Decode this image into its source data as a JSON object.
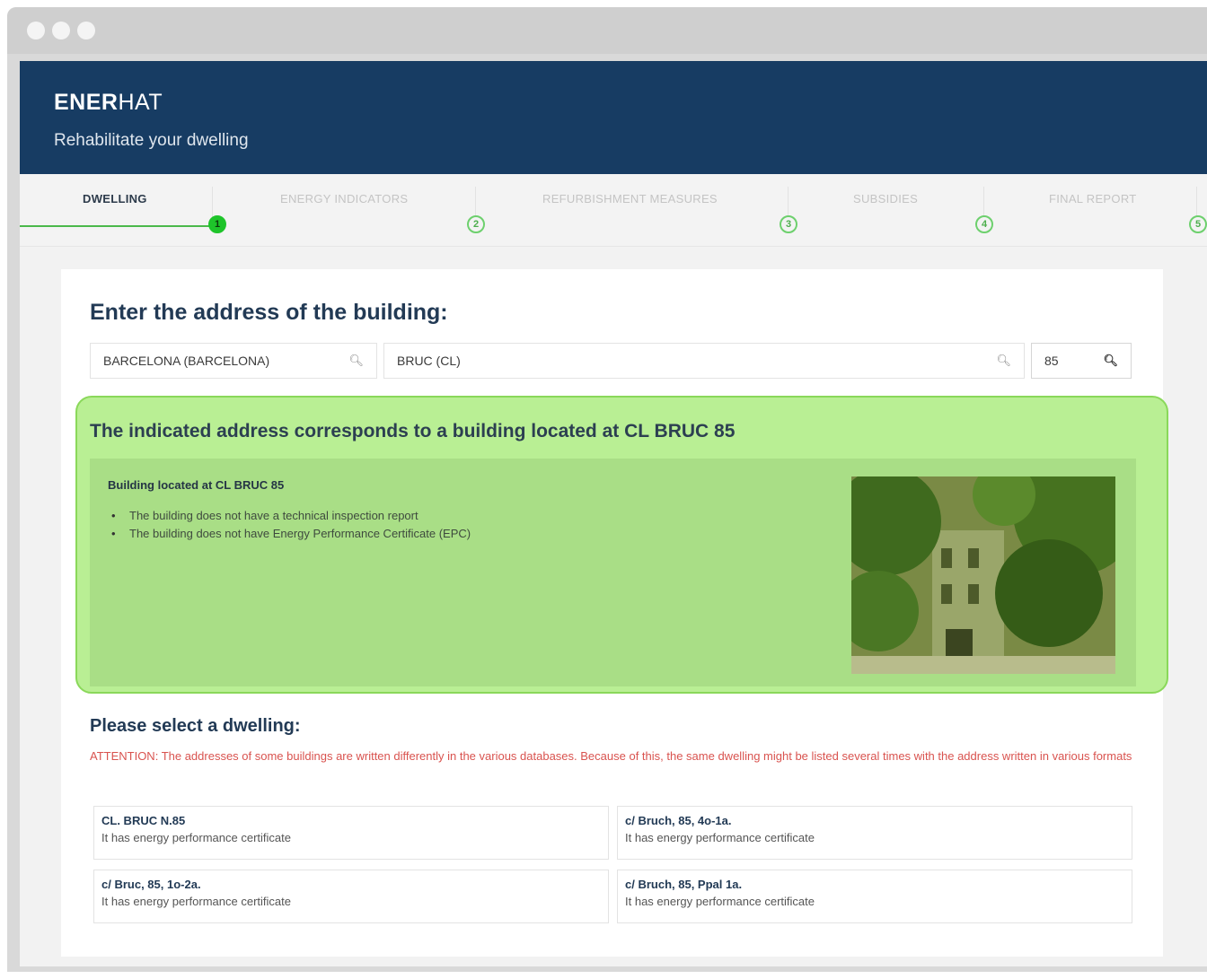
{
  "app": {
    "logo_bold": "ENER",
    "logo_light": "HAT",
    "tagline": "Rehabilitate your dwelling"
  },
  "steps": [
    {
      "label": "DWELLING",
      "num": "1",
      "active": true
    },
    {
      "label": "ENERGY INDICATORS",
      "num": "2",
      "active": false
    },
    {
      "label": "REFURBISHMENT MEASURES",
      "num": "3",
      "active": false
    },
    {
      "label": "SUBSIDIES",
      "num": "4",
      "active": false
    },
    {
      "label": "FINAL REPORT",
      "num": "5",
      "active": false
    }
  ],
  "address": {
    "title": "Enter the address of the building:",
    "municipality": "BARCELONA (BARCELONA)",
    "street": "BRUC (CL)",
    "number": "85"
  },
  "building": {
    "title": "The indicated address corresponds to a building located at CL BRUC 85",
    "heading": "Building located at CL BRUC 85",
    "items": [
      "The building does not have a technical inspection report",
      "The building does not have Energy Performance Certificate (EPC)"
    ]
  },
  "dwellings": {
    "title": "Please select a dwelling:",
    "attention": "ATTENTION: The addresses of some buildings are written differently in the various databases. Because of this, the same dwelling might be listed several times with the address written in various formats",
    "items": [
      {
        "address": "CL. BRUC N.85",
        "status": "It has energy performance certificate"
      },
      {
        "address": "c/ Bruch, 85, 4o-1a.",
        "status": "It has energy performance certificate"
      },
      {
        "address": "c/ Bruc, 85, 1o-2a.",
        "status": "It has energy performance certificate"
      },
      {
        "address": "c/ Bruch, 85, Ppal 1a.",
        "status": "It has energy performance certificate"
      }
    ]
  },
  "colors": {
    "header": "#173c63",
    "accent_green": "#1ec42a",
    "found_box": "#b9ef94",
    "attention": "#d9534f"
  }
}
